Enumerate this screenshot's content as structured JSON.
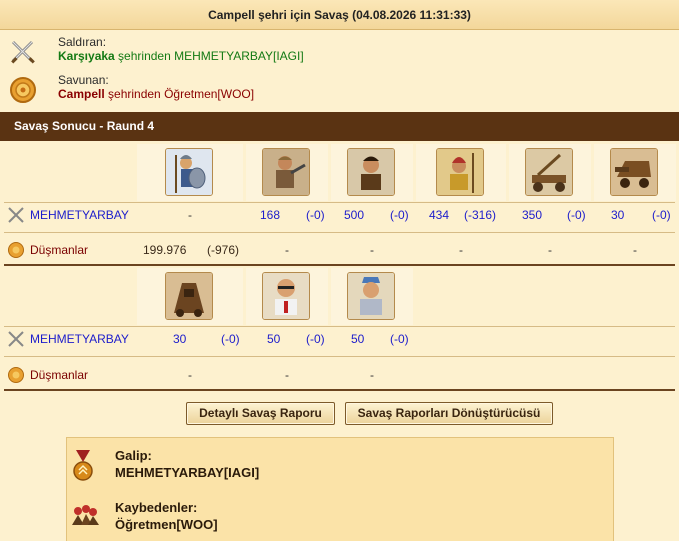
{
  "title": "Campell şehri için Savaş (04.08.2026 11:31:33)",
  "attacker": {
    "role": "Saldıran:",
    "city": "Karşıyaka",
    "middle": " şehrinden ",
    "player": "MEHMETYARBAY[IAGI]"
  },
  "defender": {
    "role": "Savunan:",
    "city": "Campell",
    "middle": " şehrinden ",
    "player": "Öğretmen[WOO]"
  },
  "round_title": "Savaş Sonucu - Raund 4",
  "row1": {
    "attacker_name": "MEHMETYARBAY",
    "attacker_values": [
      {
        "n": "-",
        "l": ""
      },
      {
        "n": "168",
        "l": "(-0)"
      },
      {
        "n": "500",
        "l": "(-0)"
      },
      {
        "n": "434",
        "l": "(-316)"
      },
      {
        "n": "350",
        "l": "(-0)"
      },
      {
        "n": "30",
        "l": "(-0)"
      }
    ],
    "defender_name": "Düşmanlar",
    "defender_values": [
      {
        "n": "199.976",
        "l": "(-976)"
      },
      {
        "n": "-",
        "l": ""
      },
      {
        "n": "-",
        "l": ""
      },
      {
        "n": "-",
        "l": ""
      },
      {
        "n": "-",
        "l": ""
      },
      {
        "n": "-",
        "l": ""
      }
    ]
  },
  "row2": {
    "attacker_name": "MEHMETYARBAY",
    "attacker_values": [
      {
        "n": "30",
        "l": "(-0)"
      },
      {
        "n": "50",
        "l": "(-0)"
      },
      {
        "n": "50",
        "l": "(-0)"
      }
    ],
    "defender_name": "Düşmanlar",
    "defender_values": [
      {
        "n": "-",
        "l": ""
      },
      {
        "n": "-",
        "l": ""
      },
      {
        "n": "-",
        "l": ""
      }
    ]
  },
  "buttons": {
    "detailed": "Detaylı Savaş Raporu",
    "converter": "Savaş Raporları Dönüştürücüsü"
  },
  "result": {
    "winner_label": "Galip:",
    "winner": "MEHMETYARBAY[IAGI]",
    "losers_label": "Kaybedenler:",
    "losers": "Öğretmen[WOO]"
  },
  "colors": {
    "header_brown": "#5a3312",
    "attacker_blue": "#1c1ccc",
    "defender_red": "#7a0000",
    "attacker_green": "#147a14"
  }
}
